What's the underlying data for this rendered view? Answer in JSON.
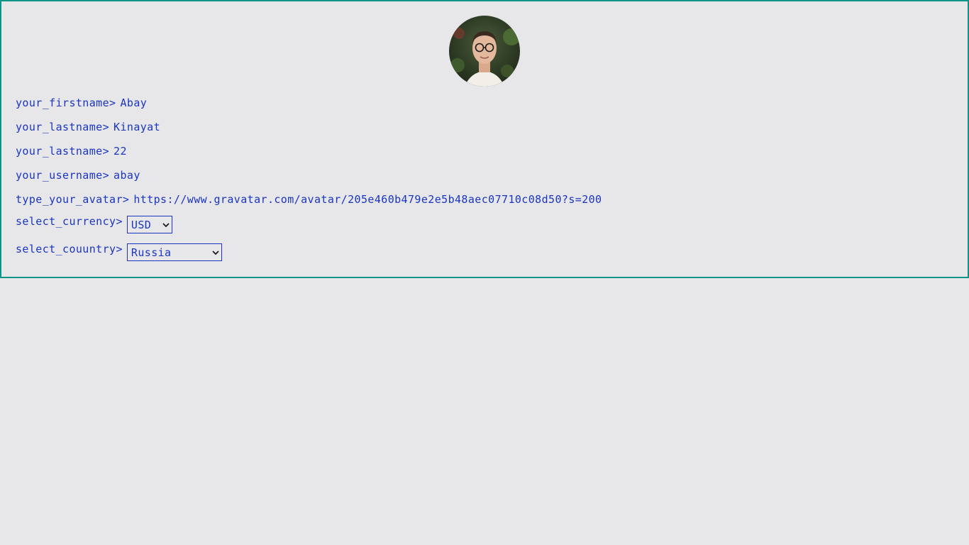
{
  "avatar": {
    "alt": "user avatar photo"
  },
  "profile": {
    "firstname_label": "your_firstname>",
    "firstname_value": "Abay",
    "lastname_label": "your_lastname>",
    "lastname_value": "Kinayat",
    "age_label": "your_lastname>",
    "age_value": "22",
    "username_label": "your_username>",
    "username_value": "abay",
    "avatar_label": "type_your_avatar>",
    "avatar_value": "https://www.gravatar.com/avatar/205e460b479e2e5b48aec07710c08d50?s=200",
    "currency_label": "select_currency>",
    "currency_value": "USD",
    "country_label": "select_couuntry>",
    "country_value": "Russia"
  },
  "colors": {
    "text": "#1a35c0",
    "border": "#0a9486",
    "background": "#e7e7e9"
  },
  "icons": {
    "dropdown": "chevron-down-icon"
  }
}
